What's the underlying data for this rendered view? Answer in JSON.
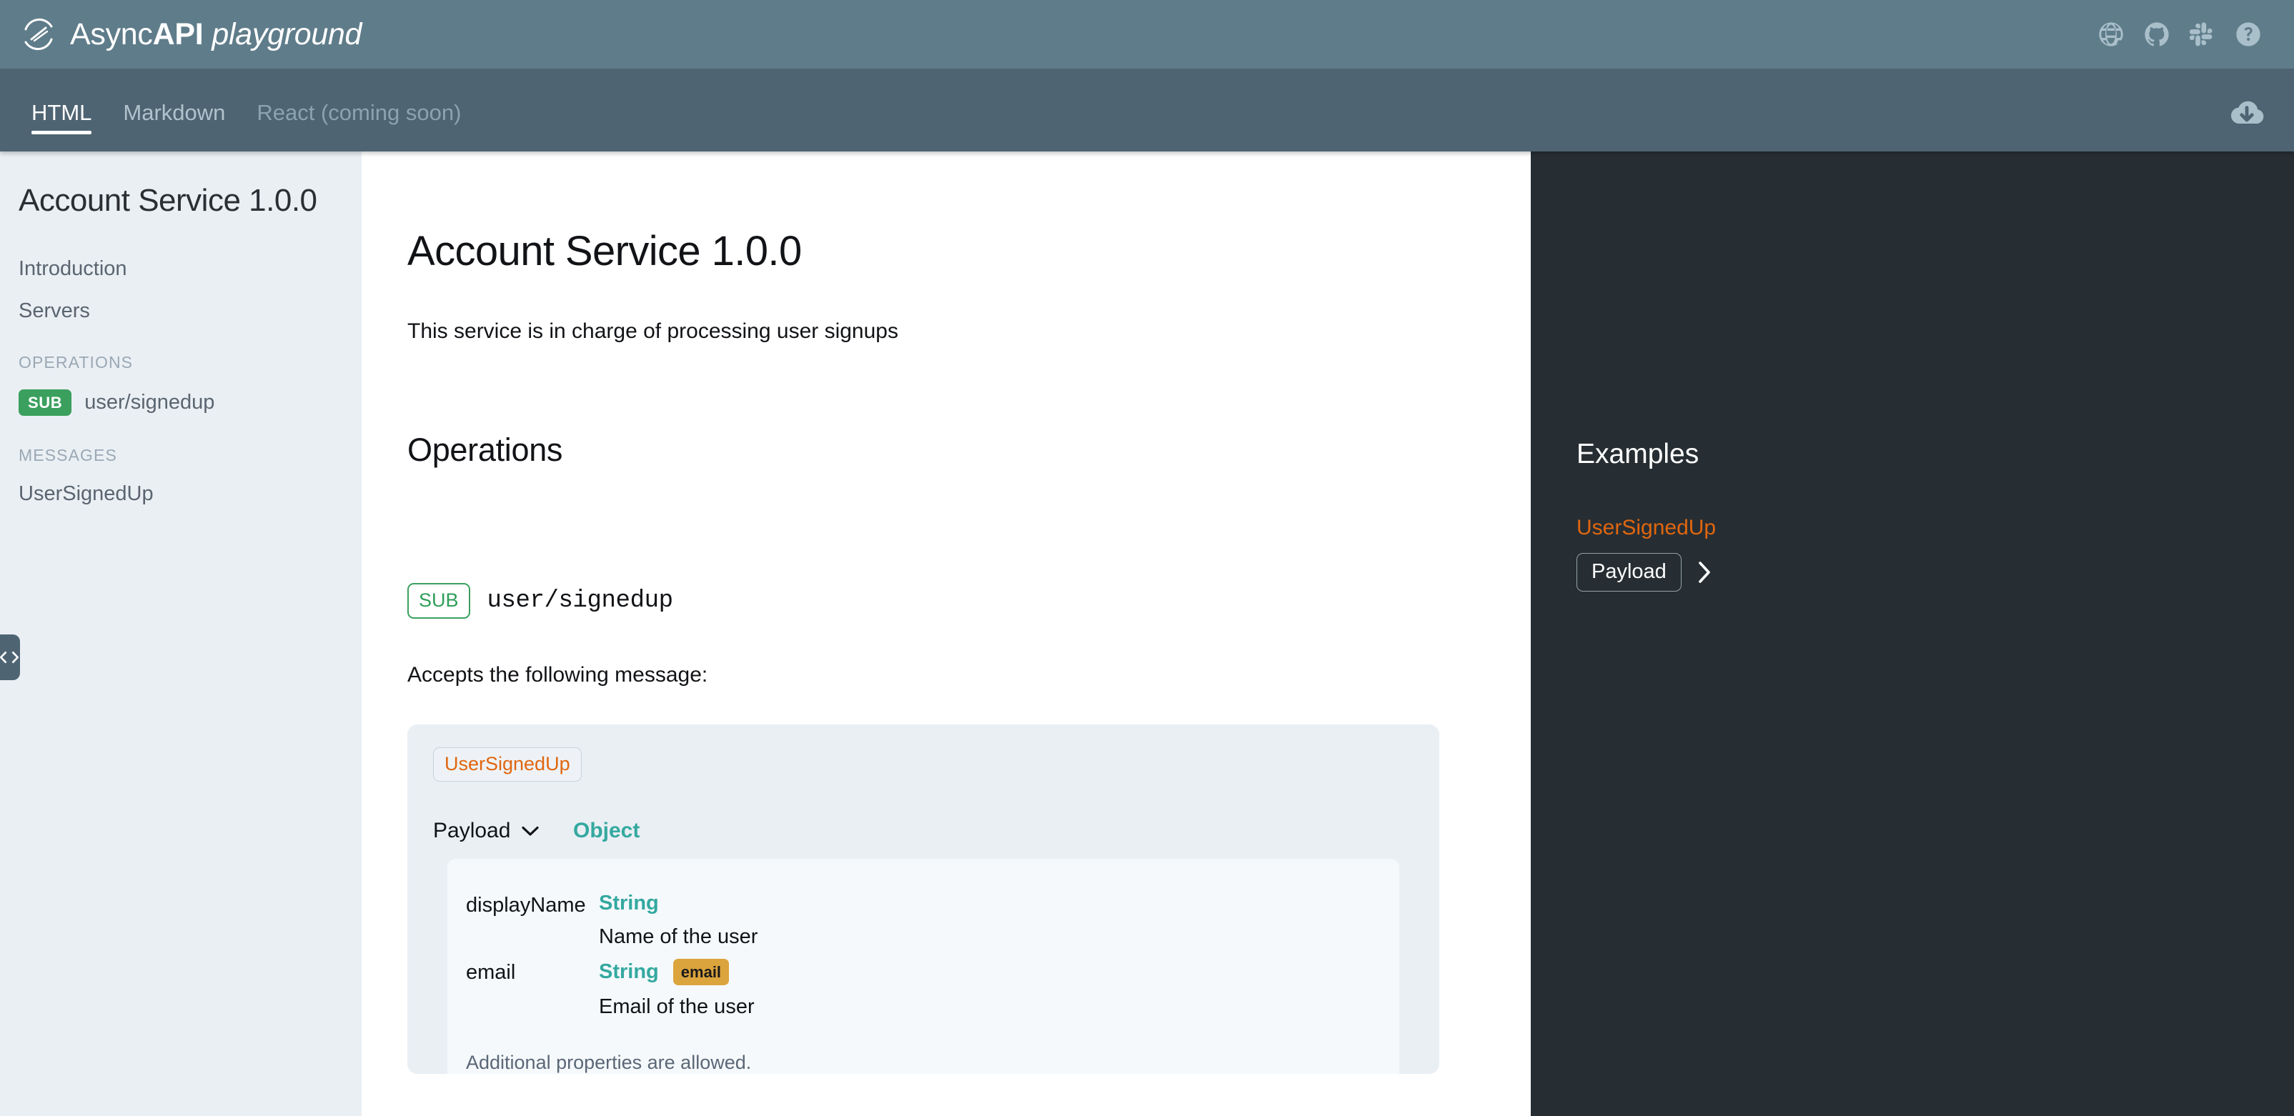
{
  "header": {
    "brand_async": "Async",
    "brand_api": "API",
    "brand_playground": "playground",
    "logo_icon": "asyncapi-logo-icon",
    "icons": [
      {
        "name": "globe-icon",
        "label": "Website"
      },
      {
        "name": "github-icon",
        "label": "GitHub"
      },
      {
        "name": "slack-icon",
        "label": "Slack"
      },
      {
        "name": "help-icon",
        "label": "Help"
      }
    ],
    "bg_color": "#5f7c8a"
  },
  "tabbar": {
    "bg_color": "#4e6472",
    "tabs": [
      {
        "label": "HTML",
        "state": "active"
      },
      {
        "label": "Markdown",
        "state": "inactive"
      },
      {
        "label": "React (coming soon)",
        "state": "disabled"
      }
    ],
    "download_icon": "cloud-download-icon"
  },
  "sidebar": {
    "title": "Account Service 1.0.0",
    "links": [
      {
        "label": "Introduction"
      },
      {
        "label": "Servers"
      }
    ],
    "sections": [
      {
        "heading": "OPERATIONS",
        "operations": [
          {
            "badge": "SUB",
            "name": "user/signedup",
            "badge_color": "#3ba05e"
          }
        ]
      },
      {
        "heading": "MESSAGES",
        "messages": [
          {
            "label": "UserSignedUp"
          }
        ]
      }
    ],
    "collapse_icon": "code-brackets-icon",
    "bg_color": "#eaeff4"
  },
  "main": {
    "title": "Account Service 1.0.0",
    "description": "This service is in charge of processing user signups",
    "operations_heading": "Operations",
    "operation": {
      "badge": "SUB",
      "channel": "user/signedup",
      "accepts_label": "Accepts the following message:",
      "message": {
        "tag": "UserSignedUp",
        "payload_label": "Payload",
        "payload_chevron": "chevron-down-icon",
        "payload_type": "Object",
        "properties": [
          {
            "name": "displayName",
            "type": "String",
            "format": "",
            "description": "Name of the user"
          },
          {
            "name": "email",
            "type": "String",
            "format": "email",
            "description": "Email of the user"
          }
        ],
        "additional_properties": "Additional properties are allowed."
      }
    },
    "accent_type_color": "#34a9a0",
    "accent_orange": "#e0660f"
  },
  "examples": {
    "title": "Examples",
    "message_name": "UserSignedUp",
    "payload_button": "Payload",
    "expand_icon": "chevron-right-icon",
    "bg_color": "#272e33"
  }
}
